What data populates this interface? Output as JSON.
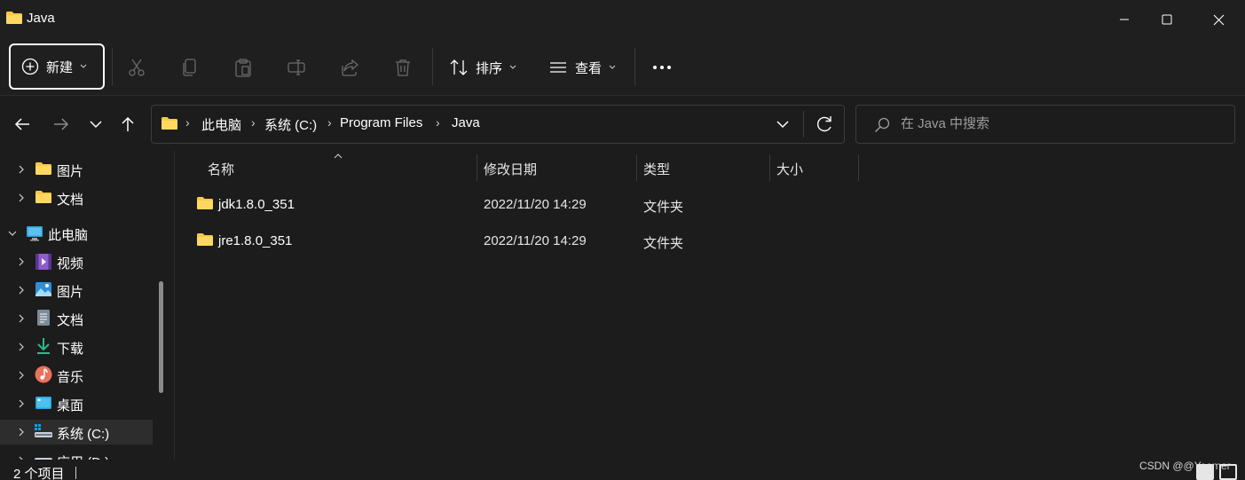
{
  "window": {
    "title": "Java"
  },
  "toolbar": {
    "new_label": "新建",
    "sort_label": "排序",
    "view_label": "查看",
    "icons": [
      "cut-icon",
      "copy-icon",
      "paste-icon",
      "rename-icon",
      "share-icon",
      "delete-icon"
    ]
  },
  "address": {
    "crumbs": [
      "此电脑",
      "系统 (C:)",
      "Program Files",
      "Java"
    ],
    "separator": "›"
  },
  "search": {
    "placeholder": "在 Java 中搜索"
  },
  "sidebar": {
    "items": [
      {
        "label": "图片",
        "icon": "folder-icon"
      },
      {
        "label": "文档",
        "icon": "folder-icon"
      },
      {
        "label": "此电脑",
        "icon": "computer-icon"
      },
      {
        "label": "视频",
        "icon": "video-icon"
      },
      {
        "label": "图片",
        "icon": "picture-icon"
      },
      {
        "label": "文档",
        "icon": "document-icon"
      },
      {
        "label": "下载",
        "icon": "download-icon"
      },
      {
        "label": "音乐",
        "icon": "music-icon"
      },
      {
        "label": "桌面",
        "icon": "desktop-icon"
      },
      {
        "label": "系统 (C:)",
        "icon": "drive-icon",
        "selected": true
      },
      {
        "label": "应用 (D:)",
        "icon": "drive-icon"
      }
    ]
  },
  "columns": {
    "name": "名称",
    "modified": "修改日期",
    "type": "类型",
    "size": "大小"
  },
  "files": [
    {
      "name": "jdk1.8.0_351",
      "modified": "2022/11/20 14:29",
      "type": "文件夹"
    },
    {
      "name": "jre1.8.0_351",
      "modified": "2022/11/20 14:29",
      "type": "文件夹"
    }
  ],
  "status": {
    "count": "2 个项目",
    "watermark": "CSDN @@Yoomer"
  },
  "colors": {
    "folder": "#f8c948",
    "accent": "#60cdff",
    "background": "#1c1c1c"
  }
}
